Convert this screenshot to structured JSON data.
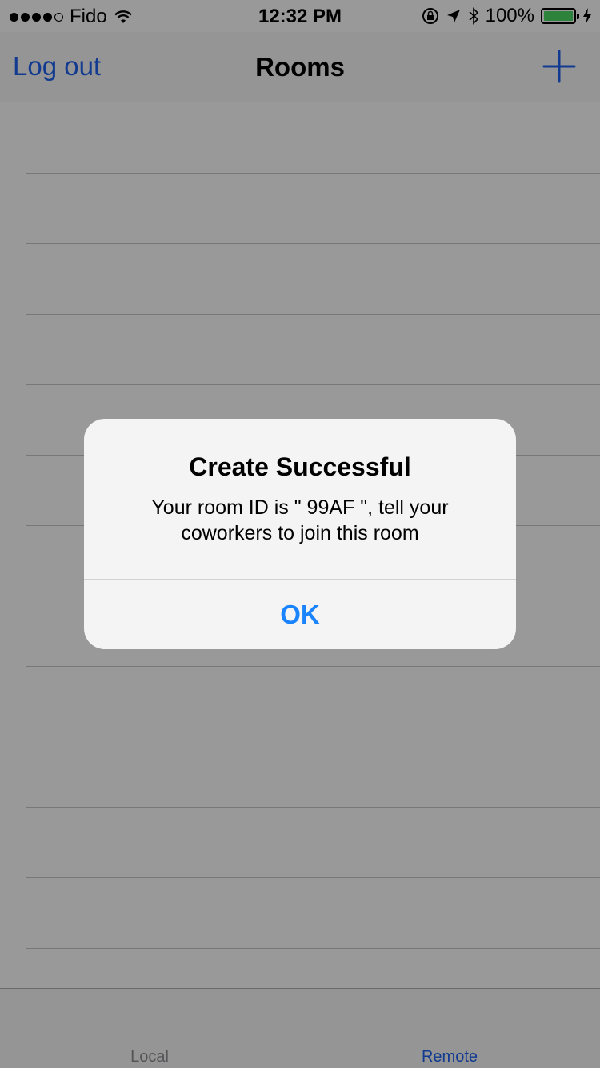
{
  "status_bar": {
    "carrier": "Fido",
    "time": "12:32 PM",
    "battery_percent": "100%",
    "signal_bars_filled": 4,
    "signal_bars_total": 5,
    "battery_level": 1.0
  },
  "nav": {
    "left_button": "Log out",
    "title": "Rooms",
    "right_icon": "plus-icon"
  },
  "table": {
    "row_count": 12
  },
  "tabs": [
    {
      "label": "Local",
      "selected": false
    },
    {
      "label": "Remote",
      "selected": true
    }
  ],
  "alert": {
    "title": "Create Successful",
    "message": "Your room ID is \" 99AF \", tell your coworkers to join this room",
    "button": "OK"
  },
  "colors": {
    "tint": "#1d62f0",
    "alert_button": "#1a84ff",
    "battery": "#4cd964"
  }
}
